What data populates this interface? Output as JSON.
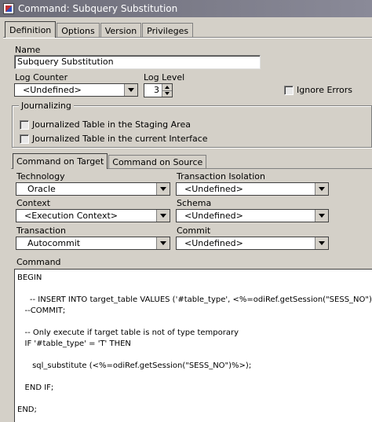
{
  "window": {
    "title": "Command: Subquery Substitution"
  },
  "tabs": [
    {
      "label": "Definition"
    },
    {
      "label": "Options"
    },
    {
      "label": "Version"
    },
    {
      "label": "Privileges"
    }
  ],
  "definition": {
    "name_label": "Name",
    "name_value": "Subquery Substitution",
    "log_counter_label": "Log Counter",
    "log_counter_value": "<Undefined>",
    "log_level_label": "Log Level",
    "log_level_value": "3",
    "ignore_errors_label": "Ignore Errors"
  },
  "journalizing": {
    "legend": "Journalizing",
    "option1": "Journalized Table in the Staging Area",
    "option2": "Journalized Table in the current Interface"
  },
  "subtabs": [
    {
      "label": "Command on Target"
    },
    {
      "label": "Command on Source"
    }
  ],
  "target": {
    "technology_label": "Technology",
    "technology_value": "Oracle",
    "transaction_isolation_label": "Transaction Isolation",
    "transaction_isolation_value": "<Undefined>",
    "context_label": "Context",
    "context_value": "<Execution Context>",
    "schema_label": "Schema",
    "schema_value": "<Undefined>",
    "transaction_label": "Transaction",
    "transaction_value": "Autocommit",
    "commit_label": "Commit",
    "commit_value": "<Undefined>",
    "command_label": "Command",
    "command_lines": [
      "BEGIN",
      "",
      "     -- INSERT INTO target_table VALUES ('#table_type', <%=odiRef.getSession(\"SESS_NO\")%>);",
      "   --COMMIT;",
      "",
      "   -- Only execute if target table is not of type temporary",
      "   IF '#table_type' = 'T' THEN",
      "",
      "      sql_substitute (<%=odiRef.getSession(\"SESS_NO\")%>);",
      "",
      "   END IF;",
      "",
      "END;"
    ]
  }
}
